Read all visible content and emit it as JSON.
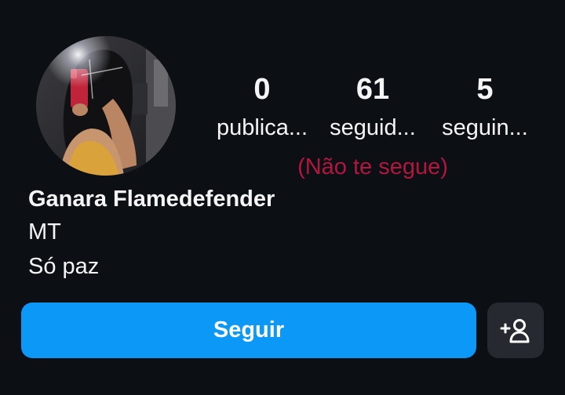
{
  "profile": {
    "name": "Ganara Flamedefender",
    "bio_lines": [
      "MT",
      "Só paz"
    ],
    "avatar_icon": "profile-photo",
    "stats": [
      {
        "value": "0",
        "label": "publica..."
      },
      {
        "value": "61",
        "label": "seguid..."
      },
      {
        "value": "5",
        "label": "seguin..."
      }
    ],
    "relationship_note": "(Não te segue)"
  },
  "actions": {
    "follow_label": "Seguir",
    "suggest_icon": "add-person-icon"
  },
  "colors": {
    "background": "#0c0f14",
    "text": "#f5f5f5",
    "accent": "#0b98f6",
    "warning": "#b3163f",
    "secondary_button": "#26292f"
  }
}
